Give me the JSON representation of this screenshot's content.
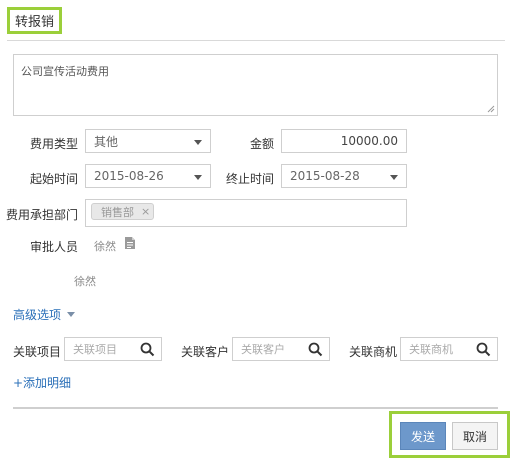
{
  "header": {
    "title": "转报销"
  },
  "description": {
    "value": "公司宣传活动费用"
  },
  "form": {
    "expense_type": {
      "label": "费用类型",
      "value": "其他"
    },
    "amount": {
      "label": "金额",
      "value": "10000.00"
    },
    "start_time": {
      "label": "起始时间",
      "value": "2015-08-26"
    },
    "end_time": {
      "label": "终止时间",
      "value": "2015-08-28"
    },
    "department": {
      "label": "费用承担部门",
      "tag": "销售部",
      "tag_remove": "×"
    },
    "approver": {
      "label": "审批人员",
      "name": "徐然",
      "selected_name": "徐然"
    }
  },
  "advanced": {
    "label": "高级选项"
  },
  "related": {
    "project": {
      "label": "关联项目",
      "placeholder": "关联项目"
    },
    "customer": {
      "label": "关联客户",
      "placeholder": "关联客户"
    },
    "opportunity": {
      "label": "关联商机",
      "placeholder": "关联商机"
    }
  },
  "add_detail": {
    "label": "+添加明细"
  },
  "actions": {
    "send_label": "发送",
    "cancel_label": "取消"
  },
  "icons": {
    "dropdown": "chevron-down-icon",
    "document": "document-icon",
    "search": "search-icon",
    "remove": "close-icon",
    "resize": "resize-grip-icon"
  },
  "colors": {
    "highlight_outline": "#9bcf3a",
    "primary_button": "#6d98cb",
    "link": "#2a6fb8"
  }
}
